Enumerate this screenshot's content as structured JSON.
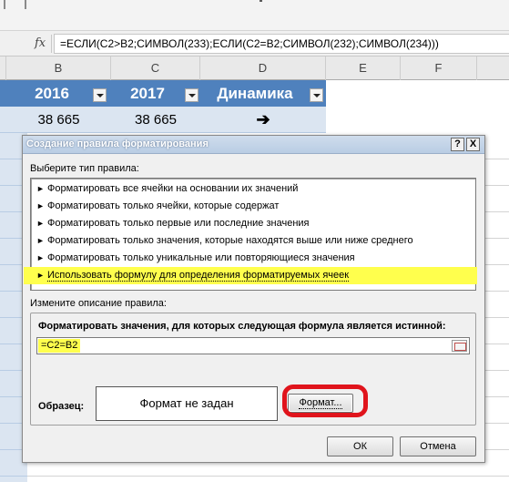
{
  "formula_bar": {
    "fx_label": "fx",
    "formula": "=ЕСЛИ(C2>B2;СИМВОЛ(233);ЕСЛИ(C2=B2;СИМВОЛ(232);СИМВОЛ(234)))"
  },
  "columns": [
    "B",
    "C",
    "D",
    "E",
    "F"
  ],
  "table": {
    "headers": [
      "2016",
      "2017",
      "Динамика"
    ],
    "row": [
      "38 665",
      "38 665",
      "➔"
    ]
  },
  "dialog": {
    "title": "Создание правила форматирования",
    "help_label": "?",
    "close_label": "X",
    "select_type_label": "Выберите тип правила:",
    "rule_types": [
      "Форматировать все ячейки на основании их значений",
      "Форматировать только ячейки, которые содержат",
      "Форматировать только первые или последние значения",
      "Форматировать только значения, которые находятся выше или ниже среднего",
      "Форматировать только уникальные или повторяющиеся значения",
      "Использовать формулу для определения форматируемых ячеек"
    ],
    "bullet": "►",
    "edit_description_label": "Измените описание правила:",
    "formula_label": "Форматировать значения, для которых следующая формула является истинной:",
    "rule_formula": "=C2=B2",
    "sample_label": "Образец:",
    "sample_text": "Формат не задан",
    "format_button": "Формат...",
    "ok_button": "ОК",
    "cancel_button": "Отмена"
  },
  "colors": {
    "table_header": "#4f81bd",
    "table_row": "#dbe5f1",
    "highlight": "#ffff4d",
    "annotation_ring": "#e0141c"
  }
}
